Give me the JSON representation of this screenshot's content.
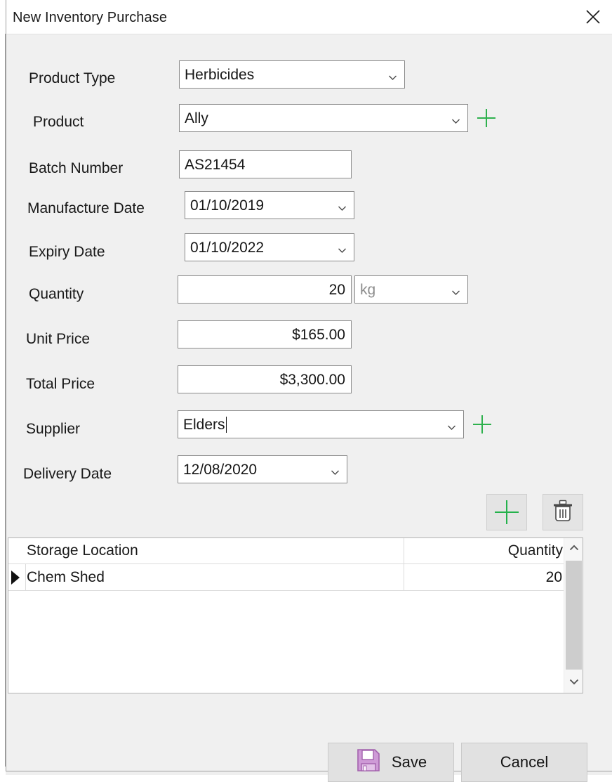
{
  "window": {
    "title": "New Inventory Purchase",
    "close_icon": "close-icon"
  },
  "colors": {
    "accent_green": "#2fb14e",
    "dialog_bg": "#f0f0f0",
    "titlebar_bg": "#ffffff",
    "field_border": "#8a8a8a",
    "save_icon": "#c27fc9"
  },
  "form": {
    "fields": [
      {
        "label": "Product Type",
        "name": "product-type",
        "type": "combobox",
        "value": "Herbicides",
        "has_add_button": false
      },
      {
        "label": "Product",
        "name": "product",
        "type": "combobox",
        "value": "Ally",
        "has_add_button": true
      },
      {
        "label": "Batch Number",
        "name": "batch-number",
        "type": "text",
        "value": "AS21454",
        "has_add_button": false
      },
      {
        "label": "Manufacture Date",
        "name": "manufacture-date",
        "type": "datepicker",
        "value": "01/10/2019",
        "has_add_button": false
      },
      {
        "label": "Expiry Date",
        "name": "expiry-date",
        "type": "datepicker",
        "value": "01/10/2022",
        "has_add_button": false
      },
      {
        "label": "Quantity",
        "name": "quantity",
        "type": "number",
        "value": "20",
        "unit_value": "kg",
        "has_add_button": false
      },
      {
        "label": "Unit Price",
        "name": "unit-price",
        "type": "currency",
        "value": "$165.00",
        "has_add_button": false
      },
      {
        "label": "Total Price",
        "name": "total-price",
        "type": "currency",
        "value": "$3,300.00",
        "has_add_button": false
      },
      {
        "label": "Supplier",
        "name": "supplier",
        "type": "combobox",
        "value": "Elders",
        "focused": true,
        "has_add_button": true
      },
      {
        "label": "Delivery Date",
        "name": "delivery-date",
        "type": "datepicker",
        "value": "12/08/2020",
        "has_add_button": false
      }
    ]
  },
  "grid_toolbar": {
    "add_icon": "plus-icon",
    "delete_icon": "trash-icon"
  },
  "grid": {
    "columns": [
      "Storage Location",
      "Quantity"
    ],
    "rows": [
      {
        "storage_location": "Chem Shed",
        "quantity": "20",
        "selected": true
      }
    ],
    "scrollbar": {
      "up_icon": "chevron-up-icon",
      "down_icon": "chevron-down-icon"
    }
  },
  "footer": {
    "save_label": "Save",
    "save_icon": "floppy-disk-icon",
    "cancel_label": "Cancel"
  }
}
